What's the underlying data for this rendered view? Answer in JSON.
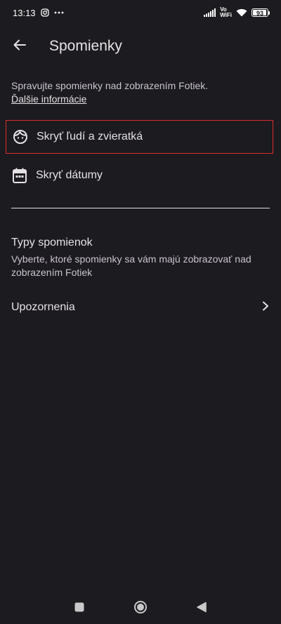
{
  "status_bar": {
    "time": "13:13",
    "battery": "93",
    "battery_level": 0.93,
    "vowifi_top": "Vo",
    "vowifi_bottom": "WiFi",
    "icons": [
      "instagram-icon",
      "more-horiz-icon",
      "signal-icon",
      "wifi-icon",
      "battery-icon"
    ]
  },
  "appbar": {
    "title": "Spomienky",
    "back_icon": "arrow-back-icon"
  },
  "description": {
    "text": "Spravujte spomienky nad zobrazením Fotiek.",
    "link": "Ďalšie informácie"
  },
  "options": [
    {
      "label": "Skryť ľudí a zvieratká",
      "icon": "face-icon"
    },
    {
      "label": "Skryť dátumy",
      "icon": "calendar-icon"
    }
  ],
  "memory_types": {
    "title": "Typy spomienok",
    "subtitle": "Vyberte, ktoré spomienky sa vám majú zobrazovať nad zobrazením Fotiek"
  },
  "notifications": {
    "label": "Upozornenia",
    "icon": "chevron-right-icon"
  },
  "colors": {
    "background": "#1c1b1f",
    "text": "#e6e1e5",
    "secondary_text": "#cac4d0",
    "highlight_border": "#d92d2d"
  }
}
